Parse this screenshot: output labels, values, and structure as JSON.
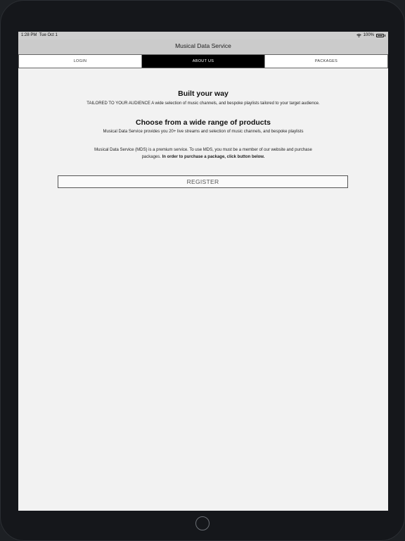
{
  "status_bar": {
    "time": "1:28 PM",
    "date": "Tue Oct 1",
    "battery": "100%",
    "wifi_icon": "wifi-icon",
    "battery_icon": "battery-icon"
  },
  "nav": {
    "title": "Musical Data Service"
  },
  "tabs": [
    {
      "label": "LOGIN",
      "active": false
    },
    {
      "label": "ABOUT US",
      "active": true
    },
    {
      "label": "PACKAGES",
      "active": false
    }
  ],
  "main": {
    "section1": {
      "heading": "Built your way",
      "text": "TAILORED TO YOUR AUDIENCE A wide selection of music channels, and bespoke playlists tailored to your target audience."
    },
    "section2": {
      "heading": "Choose from a wide range of products",
      "text": "Musical Data Service provides you 20+ live streams and selection of music channels, and bespoke playlists"
    },
    "info": {
      "line1": "Musical Data Service (MDS) is a premium service. To use MDS, you must be a member of our website and purchase",
      "line2_prefix": "packages. ",
      "line2_bold": "In order to purchase a package, click button below."
    },
    "register_label": "REGISTER"
  },
  "colors": {
    "active_tab_bg": "#000000",
    "screen_bg": "#f2f2f2",
    "navbar_bg": "#cbcbcb"
  }
}
